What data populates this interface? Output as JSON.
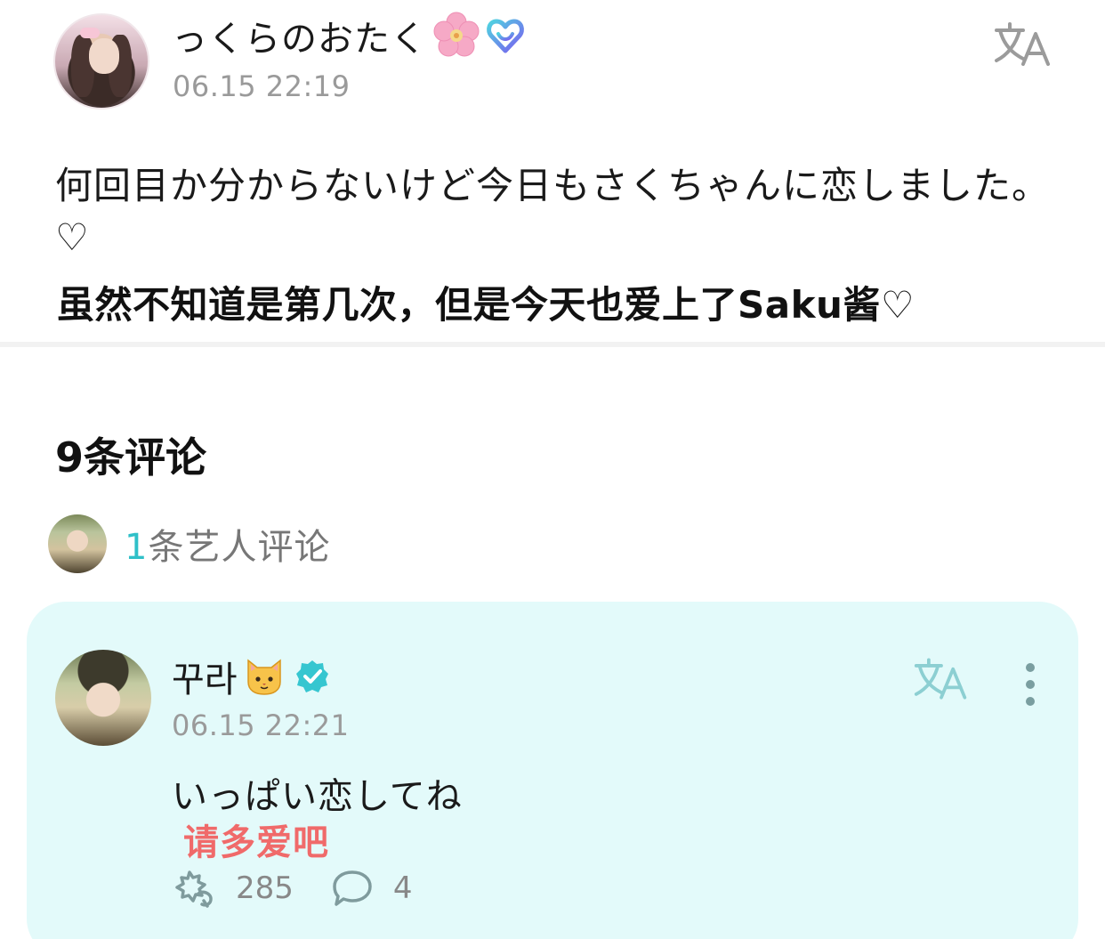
{
  "post": {
    "author": "っくらのおたく",
    "timestamp": "06.15 22:19",
    "text": "何回目か分からないけど今日もさくちゃんに恋しました。♡",
    "translation": "虽然不知道是第几次，但是今天也爱上了Saku酱♡"
  },
  "comments": {
    "count_label": "9条评论",
    "artist_summary": {
      "count": "1",
      "label": "条艺人评论"
    },
    "items": [
      {
        "author": "꾸라",
        "timestamp": "06.15 22:21",
        "text": "いっぱい恋してね",
        "translation": "请多爱吧",
        "likes": "285",
        "replies": "4"
      }
    ]
  },
  "colors": {
    "accent": "#2fc0c8",
    "card_bg": "#e3fafa",
    "translation_red": "#f06a6a",
    "muted": "#9a9a9a"
  },
  "icons": [
    "flower-icon",
    "heart-badge-icon",
    "translate-icon",
    "cat-icon",
    "verified-icon",
    "more-icon",
    "like-icon",
    "reply-icon"
  ]
}
